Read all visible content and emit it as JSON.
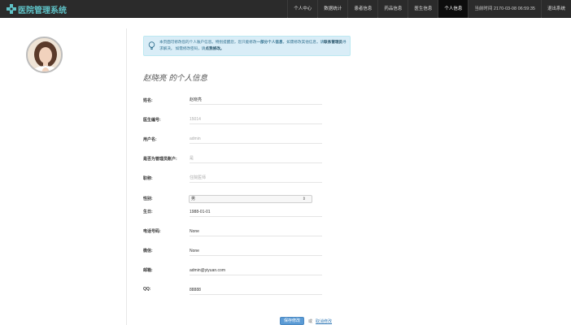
{
  "brand": {
    "title": "医院管理系统"
  },
  "nav": {
    "items": [
      {
        "label": "个人中心"
      },
      {
        "label": "数据统计"
      },
      {
        "label": "患者信息"
      },
      {
        "label": "药品信息"
      },
      {
        "label": "医生信息"
      },
      {
        "label": "个人信息",
        "active": true
      }
    ],
    "time_text": "当前时间 2170-03-08 06:59:35",
    "logout": "退出系统"
  },
  "alert": {
    "text_1": "本页面可修改您的个人账户信息。特别提醒您，您只能修改",
    "text_bold": "一部分个人信息",
    "text_2": "，如需修改其他信息，请",
    "link_admin": "联系管理员",
    "text_3": "寻求解决。 如需修改密码，请",
    "link_password": "点我修改。"
  },
  "page_title": "赵晓亮 的个人信息",
  "form": {
    "name_label": "姓名:",
    "name_value": "赵晓亮",
    "doctor_no_label": "医生编号:",
    "doctor_no_value": "15014",
    "username_label": "用户名:",
    "username_value": "admin",
    "is_admin_label": "是否为管理员账户:",
    "is_admin_value": "是",
    "title_label": "职称:",
    "title_value": "住院医师",
    "gender_label": "性别:",
    "gender_value": "男",
    "birthday_label": "生日:",
    "birthday_value": "1988-01-01",
    "phone_label": "电话号码:",
    "phone_value": "None",
    "wechat_label": "微信:",
    "wechat_value": "None",
    "email_label": "邮箱:",
    "email_value": "admin@yiyuan.com",
    "qq_label": "QQ:",
    "qq_value": "88888"
  },
  "actions": {
    "save_label": "保存修改",
    "or_text": "或",
    "cancel_label": "取消修改"
  },
  "colors": {
    "navbar": "#2b2b2b",
    "brand": "#5fc3c8",
    "alert_bg": "#d9edf7",
    "primary": "#5b9bd5"
  }
}
